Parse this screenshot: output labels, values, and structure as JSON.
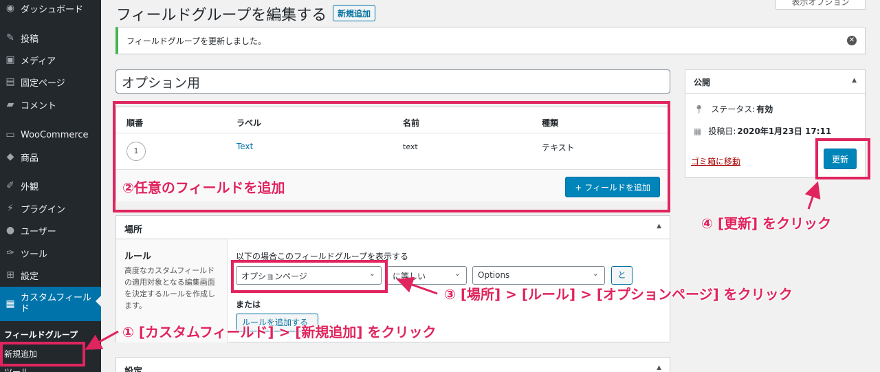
{
  "sidebar": {
    "items": [
      {
        "icon": "dashboard-icon",
        "label": "ダッシュボード"
      },
      {
        "icon": "pin-icon",
        "label": "投稿"
      },
      {
        "icon": "media-icon",
        "label": "メディア"
      },
      {
        "icon": "page-icon",
        "label": "固定ページ"
      },
      {
        "icon": "comment-icon",
        "label": "コメント"
      },
      {
        "icon": "woo-icon",
        "label": "WooCommerce"
      },
      {
        "icon": "product-icon",
        "label": "商品"
      },
      {
        "icon": "appearance-icon",
        "label": "外観"
      },
      {
        "icon": "plugin-icon",
        "label": "プラグイン"
      },
      {
        "icon": "user-icon",
        "label": "ユーザー"
      },
      {
        "icon": "tool-icon",
        "label": "ツール"
      },
      {
        "icon": "settings-icon",
        "label": "設定"
      },
      {
        "icon": "custom-fields-icon",
        "label": "カスタムフィールド"
      }
    ],
    "sub": {
      "field_groups": "フィールドグループ",
      "add_new": "新規追加",
      "tools": "ツール"
    }
  },
  "page": {
    "title": "フィールドグループを編集する",
    "add_new": "新規追加",
    "screen_options": "表示オプション",
    "notice": "フィールドグループを更新しました。",
    "group_title": "オプション用"
  },
  "fields": {
    "headers": {
      "order": "順番",
      "label": "ラベル",
      "name": "名前",
      "type": "種類"
    },
    "row": {
      "order": "1",
      "label": "Text",
      "name": "text",
      "type": "テキスト"
    },
    "add_button": "+ フィールドを追加"
  },
  "location": {
    "title": "場所",
    "rule_title": "ルール",
    "rule_desc": "高度なカスタムフィールドの適用対象となる編集画面を決定するルールを作成します。",
    "show_if": "以下の場合このフィールドグループを表示する",
    "param": "オプションページ",
    "operator": "に等しい",
    "value": "Options",
    "and": "と",
    "or": "または",
    "add_rule": "ルールを追加する"
  },
  "settings": {
    "title": "設定"
  },
  "publish": {
    "title": "公開",
    "status_label": "ステータス:",
    "status_value": "有効",
    "date_label": "投稿日:",
    "date_value": "2020年1月23日 17:11",
    "trash": "ゴミ箱に移動",
    "update": "更新"
  },
  "annotations": {
    "step1": "① [カスタムフィールド] > [新規追加] をクリック",
    "step2": "②任意のフィールドを追加",
    "step3": "③ [場所] > [ルール] > [オプションページ] をクリック",
    "step4": "④ [更新] をクリック"
  },
  "colors": {
    "accent": "#0073aa",
    "annotation": "#e0245e",
    "sidebar": "#23282d",
    "success": "#46b450"
  }
}
